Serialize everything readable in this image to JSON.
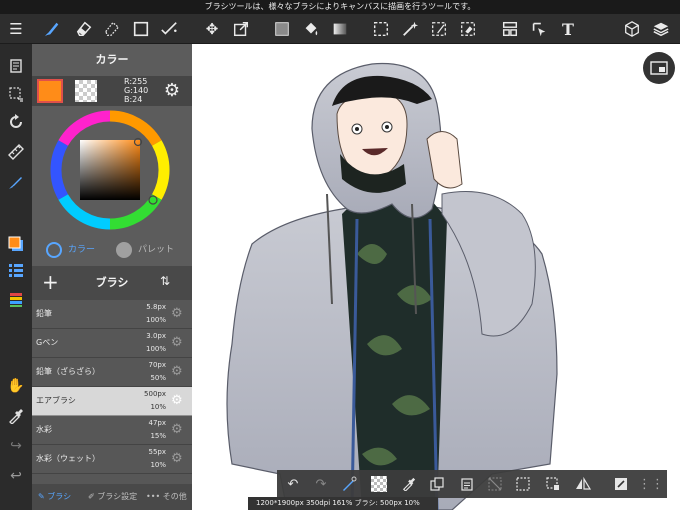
{
  "tooltip": "ブラシツールは、様々なブラシによりキャンバスに描画を行うツールです。",
  "toolbar": {
    "text_tool_label": "T"
  },
  "color_panel": {
    "title": "カラー",
    "rgb_r": "R:255",
    "rgb_g": "G:140",
    "rgb_b": "B:24",
    "tab_color": "カラー",
    "tab_palette": "パレット",
    "main_color": "#ff8c18"
  },
  "brush_panel": {
    "title": "ブラシ",
    "add_label": "+",
    "brushes": [
      {
        "name": "鉛筆",
        "size": "5.8px",
        "opacity": "100%"
      },
      {
        "name": "Gペン",
        "size": "3.0px",
        "opacity": "100%"
      },
      {
        "name": "鉛筆（ざらざら）",
        "size": "70px",
        "opacity": "50%"
      },
      {
        "name": "エアブラシ",
        "size": "500px",
        "opacity": "10%",
        "selected": true
      },
      {
        "name": "水彩",
        "size": "47px",
        "opacity": "15%"
      },
      {
        "name": "水彩（ウェット）",
        "size": "55px",
        "opacity": "10%"
      }
    ],
    "footer_brush": "ブラシ",
    "footer_settings": "ブラシ設定",
    "footer_other": "その他"
  },
  "status_bar": "1200*1900px 350dpi 161% ブラシ: 500px 10%",
  "colors": {
    "accent": "#58a6ff",
    "selection_red": "#e0504a"
  }
}
